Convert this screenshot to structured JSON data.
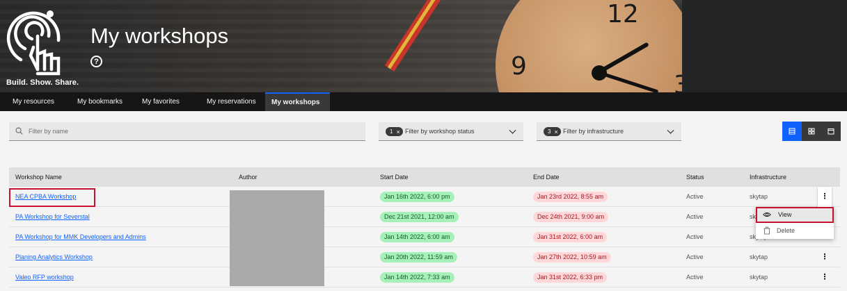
{
  "hero": {
    "title": "My workshops",
    "tagline": "Build. Show. Share.",
    "help_glyph": "?"
  },
  "nav": {
    "tabs": [
      {
        "label": "My resources"
      },
      {
        "label": "My bookmarks"
      },
      {
        "label": "My favorites"
      },
      {
        "label": "My reservations"
      },
      {
        "label": "My workshops",
        "active": true
      }
    ]
  },
  "filters": {
    "search_placeholder": "Filter by name",
    "status": {
      "count": "1",
      "label": "Filter by workshop status"
    },
    "infrastructure": {
      "count": "3",
      "label": "Filter by infrastructure"
    },
    "tag_clear": "×"
  },
  "table": {
    "headers": [
      "Workshop Name",
      "Author",
      "Start Date",
      "End Date",
      "Status",
      "Infrastructure"
    ],
    "rows": [
      {
        "name": "NEA CPBA Workshop",
        "start": "Jan 16th 2022, 6:00 pm",
        "end": "Jan 23rd 2022, 8:55 am",
        "status": "Active",
        "infra": "skytap"
      },
      {
        "name": "PA Workshop for Severstal",
        "start": "Dec 21st 2021, 12:00 am",
        "end": "Dec 24th 2021, 9:00 am",
        "status": "Active",
        "infra": "skytap"
      },
      {
        "name": "PA Workshop for MMK Developers and Admins",
        "start": "Jan 14th 2022, 6:00 am",
        "end": "Jan 31st 2022, 6:00 am",
        "status": "Active",
        "infra": "skytap"
      },
      {
        "name": "Planing Analytics Workshop",
        "start": "Jan 20th 2022, 11:59 am",
        "end": "Jan 27th 2022, 10:59 am",
        "status": "Active",
        "infra": "skytap"
      },
      {
        "name": "Valeo RFP workshop",
        "start": "Jan 14th 2022, 7:33 am",
        "end": "Jan 31st 2022, 6:33 pm",
        "status": "Active",
        "infra": "skytap"
      }
    ],
    "kebab_glyph": "⋮"
  },
  "overflow_menu": {
    "view_label": "View",
    "delete_label": "Delete"
  },
  "colors": {
    "accent": "#0f62fe",
    "highlight": "#c8102e",
    "start_pill": "#a7f0ba",
    "end_pill": "#ffd7d9"
  }
}
